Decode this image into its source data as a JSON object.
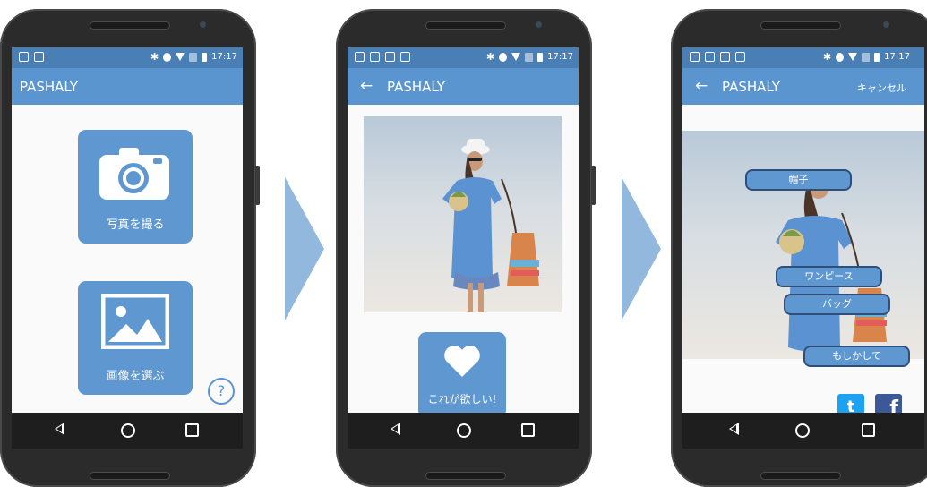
{
  "status": {
    "time": "17:17"
  },
  "screen1": {
    "app_title": "PASHALY",
    "take_photo_label": "写真を撮る",
    "choose_image_label": "画像を選ぶ",
    "help_label": "?"
  },
  "screen2": {
    "back_label": "←",
    "app_title": "PASHALY",
    "want_label": "これが欲しい!"
  },
  "screen3": {
    "back_label": "←",
    "app_title": "PASHALY",
    "cancel_label": "キャンセル",
    "tags": [
      "帽子",
      "ワンピース",
      "バッグ",
      "もしかして"
    ],
    "twitter_label": "t",
    "facebook_label": "f"
  },
  "colors": {
    "statusbar": "#4a7fb5",
    "appbar": "#5b95cf",
    "tile": "#5f97d0",
    "arrow": "#93b8de"
  }
}
